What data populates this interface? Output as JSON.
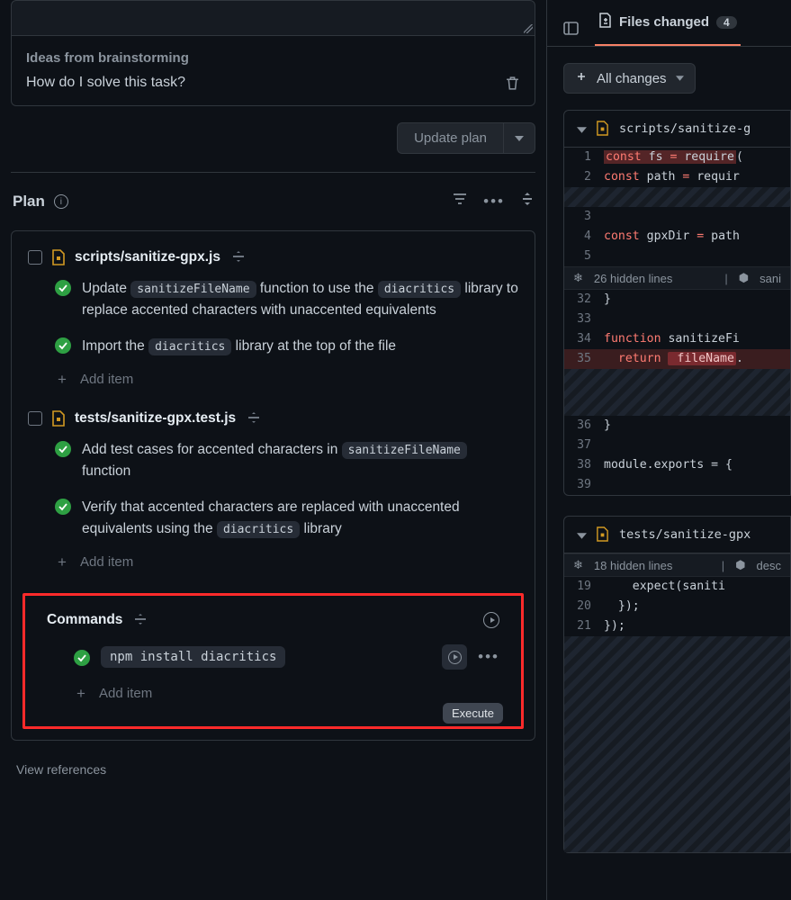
{
  "brainstorm": {
    "title": "Ideas from brainstorming",
    "prompt": "How do I solve this task?"
  },
  "update_button": "Update plan",
  "plan_title": "Plan",
  "plan": [
    {
      "file": "scripts/sanitize-gpx.js",
      "items": [
        {
          "prefix": "Update ",
          "chip": "sanitizeFileName",
          "mid1": " function to use the ",
          "chip2": "diacritics",
          "suffix": " library to replace accented characters with unaccented equivalents"
        },
        {
          "prefix": "Import the ",
          "chip": "diacritics",
          "suffix": " library at the top of the file"
        }
      ]
    },
    {
      "file": "tests/sanitize-gpx.test.js",
      "items": [
        {
          "prefix": "Add test cases for accented characters in ",
          "chip": "sanitizeFileName",
          "suffix": " function"
        },
        {
          "prefix": "Verify that accented characters are replaced with unaccented equivalents using the ",
          "chip": "diacritics",
          "suffix": " library"
        }
      ]
    }
  ],
  "add_item_label": "Add item",
  "commands": {
    "title": "Commands",
    "items": [
      {
        "cmd": "npm install diacritics"
      }
    ],
    "execute_tooltip": "Execute"
  },
  "view_references": "View references",
  "tabs": {
    "files_label": "Files changed",
    "files_count": "4"
  },
  "filter_label": "All changes",
  "diff1": {
    "filename": "scripts/sanitize-g",
    "lines": {
      "l1_no": "1",
      "l1": {
        "a": "const",
        "b": " fs ",
        "c": "=",
        "d": " require",
        "e": "("
      },
      "l2_no": "2",
      "l2": {
        "a": "const",
        "b": " path ",
        "c": "=",
        "d": " requir"
      },
      "l3_no": "3",
      "l4_no": "4",
      "l4": {
        "a": "const",
        "b": " gpxDir ",
        "c": "=",
        "d": " path"
      },
      "l5_no": "5",
      "hidden": "26 hidden lines",
      "hidden_right": "sani",
      "l32_no": "32",
      "l32": "}",
      "l33_no": "33",
      "l34_no": "34",
      "l34": {
        "a": "function",
        "b": " sanitizeFi"
      },
      "l35_no": "35",
      "l35": {
        "a": "return",
        "b": " fileName",
        "c": "."
      },
      "l36_no": "36",
      "l36": "}",
      "l37_no": "37",
      "l38_no": "38",
      "l38": "module.exports = {",
      "l39_no": "39"
    }
  },
  "diff2": {
    "filename": "tests/sanitize-gpx",
    "hidden": "18 hidden lines",
    "hidden_right": "desc",
    "lines": {
      "l19_no": "19",
      "l19": "    expect(saniti",
      "l20_no": "20",
      "l20": "  });",
      "l21_no": "21",
      "l21": "});"
    }
  }
}
